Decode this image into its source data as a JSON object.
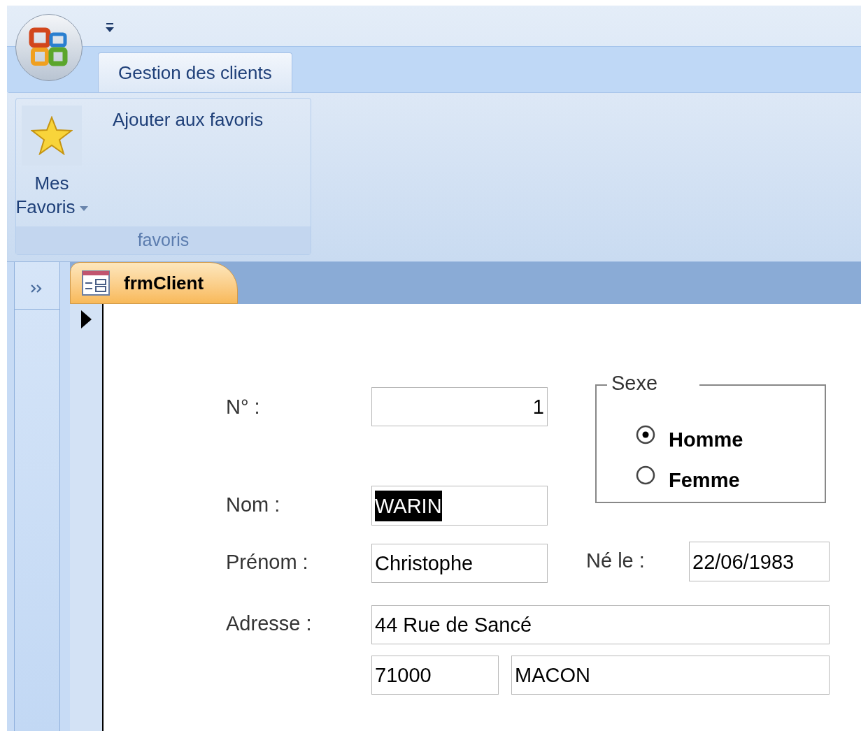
{
  "ribbon": {
    "tabs": [
      {
        "label": "Gestion des clients",
        "selected": true
      }
    ],
    "groups": [
      {
        "label": "favoris",
        "buttons": [
          {
            "kind": "large-dropdown",
            "label": "Mes Favoris"
          },
          {
            "kind": "small",
            "label": "Ajouter aux favoris"
          }
        ]
      }
    ]
  },
  "document_tabs": [
    {
      "label": "frmClient",
      "selected": true
    }
  ],
  "form": {
    "fields": [
      {
        "kind": "number",
        "label": "N° :",
        "value": "1",
        "text_selected": false
      },
      {
        "kind": "text",
        "label": "Nom :",
        "value": "WARIN",
        "text_selected": true
      },
      {
        "kind": "text",
        "label": "Prénom :",
        "value": "Christophe",
        "text_selected": false
      },
      {
        "kind": "text",
        "label": "Né le :",
        "value": "22/06/1983",
        "text_selected": false
      },
      {
        "kind": "text",
        "label": "Adresse :",
        "value": "44 Rue de Sancé",
        "text_selected": false
      },
      {
        "kind": "text",
        "value": "71000",
        "text_selected": false
      },
      {
        "kind": "text",
        "value": "MACON",
        "text_selected": false
      }
    ],
    "sex_group": {
      "title": "Sexe",
      "options": [
        {
          "label": "Homme",
          "selected": true
        },
        {
          "label": "Femme",
          "selected": false
        }
      ]
    }
  }
}
